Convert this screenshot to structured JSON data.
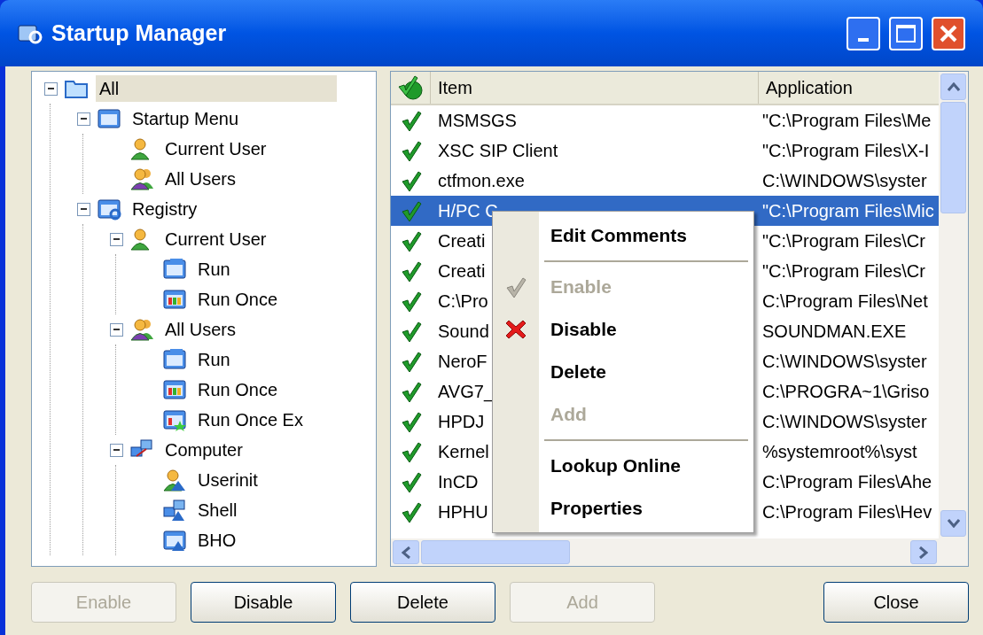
{
  "window": {
    "title": "Startup Manager"
  },
  "tree": [
    {
      "label": "All",
      "kind": "folder",
      "selected": true,
      "expanded": true,
      "children": [
        {
          "label": "Startup Menu",
          "kind": "window",
          "selected": false,
          "expanded": true,
          "children": [
            {
              "label": "Current User",
              "kind": "user",
              "selected": false
            },
            {
              "label": "All Users",
              "kind": "users",
              "selected": false
            }
          ]
        },
        {
          "label": "Registry",
          "kind": "registry",
          "selected": false,
          "expanded": true,
          "children": [
            {
              "label": "Current User",
              "kind": "user",
              "selected": false,
              "expanded": true,
              "children": [
                {
                  "label": "Run",
                  "kind": "run",
                  "selected": false
                },
                {
                  "label": "Run Once",
                  "kind": "run-once",
                  "selected": false
                }
              ]
            },
            {
              "label": "All Users",
              "kind": "users",
              "selected": false,
              "expanded": true,
              "children": [
                {
                  "label": "Run",
                  "kind": "run",
                  "selected": false
                },
                {
                  "label": "Run Once",
                  "kind": "run-once",
                  "selected": false
                },
                {
                  "label": "Run Once Ex",
                  "kind": "run-once-ex",
                  "selected": false
                }
              ]
            },
            {
              "label": "Computer",
              "kind": "computer",
              "selected": false,
              "expanded": true,
              "children": [
                {
                  "label": "Userinit",
                  "kind": "userinit",
                  "selected": false
                },
                {
                  "label": "Shell",
                  "kind": "shell",
                  "selected": false
                },
                {
                  "label": "BHO",
                  "kind": "bho",
                  "selected": false
                }
              ]
            }
          ]
        }
      ]
    }
  ],
  "table": {
    "columns": [
      "Item",
      "Application"
    ],
    "rows": [
      {
        "item": "MSMSGS",
        "application": "\"C:\\Program Files\\Me",
        "checked": true,
        "selected": false
      },
      {
        "item": "XSC SIP Client",
        "application": "\"C:\\Program Files\\X-I",
        "checked": true,
        "selected": false
      },
      {
        "item": "ctfmon.exe",
        "application": "C:\\WINDOWS\\syster",
        "checked": true,
        "selected": false
      },
      {
        "item": "H/PC C",
        "application": "\"C:\\Program Files\\Mic",
        "checked": true,
        "selected": true
      },
      {
        "item": "Creati",
        "application": "\"C:\\Program Files\\Cr",
        "checked": true,
        "selected": false
      },
      {
        "item": "Creati",
        "application": "\"C:\\Program Files\\Cr",
        "checked": true,
        "selected": false
      },
      {
        "item": "C:\\Pro",
        "application": "C:\\Program Files\\Net",
        "checked": true,
        "selected": false
      },
      {
        "item": "Sound",
        "application": "SOUNDMAN.EXE",
        "checked": true,
        "selected": false
      },
      {
        "item": "NeroF",
        "application": "C:\\WINDOWS\\syster",
        "checked": true,
        "selected": false
      },
      {
        "item": "AVG7_",
        "application": "C:\\PROGRA~1\\Griso",
        "checked": true,
        "selected": false
      },
      {
        "item": "HPDJ",
        "application": "C:\\WINDOWS\\syster",
        "checked": true,
        "selected": false
      },
      {
        "item": "Kernel",
        "application": "%systemroot%\\syst",
        "checked": true,
        "selected": false
      },
      {
        "item": "InCD",
        "application": "C:\\Program Files\\Ahe",
        "checked": true,
        "selected": false
      },
      {
        "item": "HPHU",
        "application": "C:\\Program Files\\Hev",
        "checked": true,
        "selected": false
      }
    ]
  },
  "context_menu": [
    {
      "kind": "item",
      "label": "Edit Comments",
      "disabled": false
    },
    {
      "kind": "separator"
    },
    {
      "kind": "check-item",
      "label": "Enable",
      "disabled": true
    },
    {
      "kind": "cross-item",
      "label": "Disable",
      "disabled": false
    },
    {
      "kind": "item",
      "label": "Delete",
      "disabled": false
    },
    {
      "kind": "item",
      "label": "Add",
      "disabled": true
    },
    {
      "kind": "separator"
    },
    {
      "kind": "item",
      "label": "Lookup Online",
      "disabled": false
    },
    {
      "kind": "item",
      "label": "Properties",
      "disabled": false
    }
  ],
  "buttons": [
    {
      "label": "Enable",
      "disabled": true
    },
    {
      "label": "Disable",
      "disabled": false
    },
    {
      "label": "Delete",
      "disabled": false
    },
    {
      "label": "Add",
      "disabled": true
    }
  ],
  "close_button": {
    "label": "Close",
    "disabled": false
  }
}
